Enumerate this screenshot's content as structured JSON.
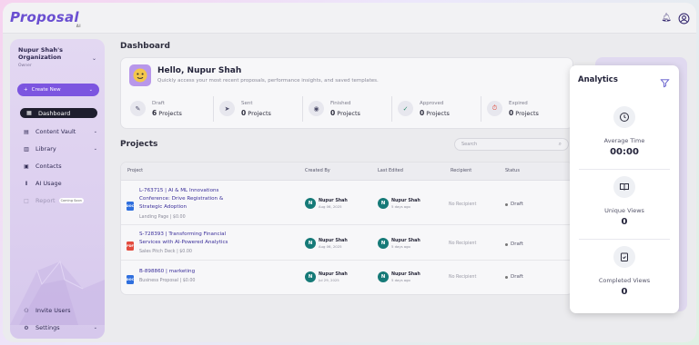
{
  "app": {
    "logo": "Proposal",
    "logo_sub": "AI"
  },
  "sidebar": {
    "org_name": "Nupur Shah's Organization",
    "org_role": "Owner",
    "create_label": "Create New",
    "items": [
      {
        "label": "Dashboard",
        "icon": "grid-icon"
      },
      {
        "label": "Content Vault",
        "icon": "vault-icon"
      },
      {
        "label": "Library",
        "icon": "library-icon"
      },
      {
        "label": "Contacts",
        "icon": "contacts-icon"
      },
      {
        "label": "AI Usage",
        "icon": "chart-icon"
      },
      {
        "label": "Report",
        "icon": "report-icon",
        "badge": "Coming Soon"
      }
    ],
    "invite_label": "Invite Users",
    "settings_label": "Settings"
  },
  "main": {
    "title": "Dashboard",
    "greeting": "Hello, Nupur Shah",
    "greeting_sub": "Quickly access your most recent proposals, performance insights, and saved templates.",
    "stats": [
      {
        "label": "Draft",
        "count": "6",
        "unit": "Projects"
      },
      {
        "label": "Sent",
        "count": "0",
        "unit": "Projects"
      },
      {
        "label": "Finished",
        "count": "0",
        "unit": "Projects"
      },
      {
        "label": "Approved",
        "count": "0",
        "unit": "Projects"
      },
      {
        "label": "Expired",
        "count": "0",
        "unit": "Projects"
      }
    ],
    "projects_title": "Projects",
    "search_placeholder": "Search",
    "columns": [
      "Project",
      "Created By",
      "Last Edited",
      "Recipient",
      "Status"
    ],
    "rows": [
      {
        "name": "L-763715 | AI & ML Innovations Conference: Drive Registration & Strategic Adoption",
        "meta": "Landing Page | $0.00",
        "file_type": "DOC",
        "created_by": "Nupur Shah",
        "created_date": "Aug 06, 2025",
        "edited_by": "Nupur Shah",
        "edited_ago": "5 days ago",
        "recipient": "No Recipient",
        "status": "Draft"
      },
      {
        "name": "S-728393 | Transforming Financial Services with AI-Powered Analytics",
        "meta": "Sales Pitch Deck | $0.00",
        "file_type": "PDF",
        "created_by": "Nupur Shah",
        "created_date": "Aug 06, 2025",
        "edited_by": "Nupur Shah",
        "edited_ago": "5 days ago",
        "recipient": "No Recipient",
        "status": "Draft"
      },
      {
        "name": "B-898860 | marketing",
        "meta": "Business Proposal | $0.00",
        "file_type": "DOC",
        "created_by": "Nupur Shah",
        "created_date": "Jul 29, 2025",
        "edited_by": "Nupur Shah",
        "edited_ago": "5 days ago",
        "recipient": "No Recipient",
        "status": "Draft"
      }
    ]
  },
  "analytics": {
    "title": "Analytics",
    "metrics": [
      {
        "label": "Average Time",
        "value": "00:00"
      },
      {
        "label": "Unique Views",
        "value": "0"
      },
      {
        "label": "Completed Views",
        "value": "0"
      }
    ]
  },
  "colors": {
    "accent": "#7c55e0",
    "avatar": "#167a78",
    "dark_nav": "#1e1e2e"
  }
}
